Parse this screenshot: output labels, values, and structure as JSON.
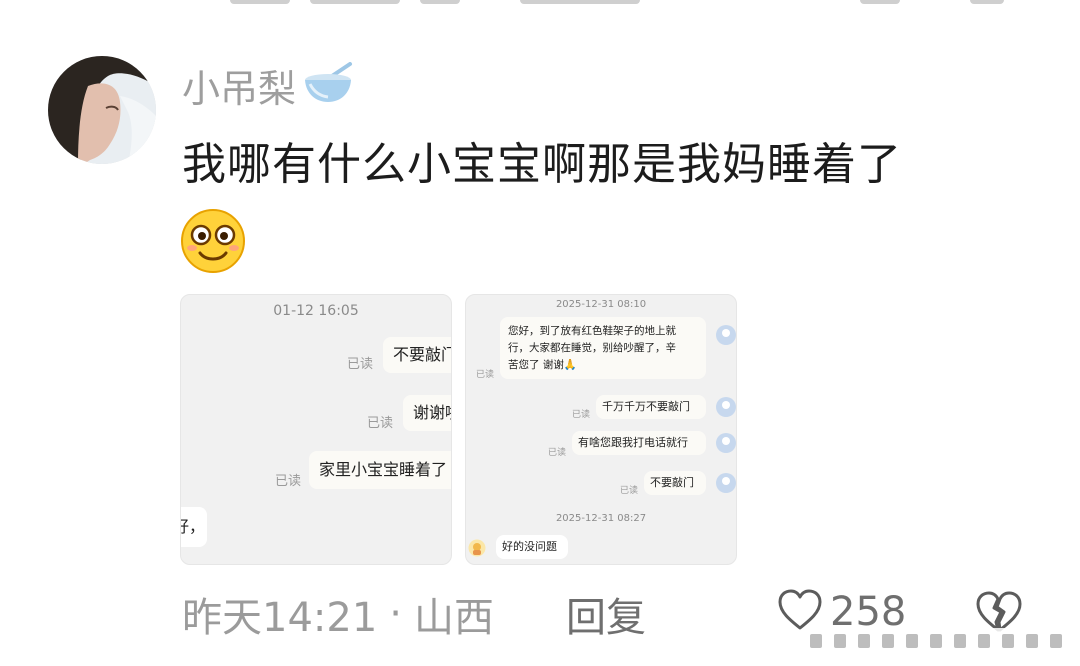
{
  "comment": {
    "username": "小吊梨",
    "text": "我哪有什么小宝宝啊那是我妈睡着了",
    "time": "昨天14:21",
    "separator": "·",
    "location": "山西",
    "reply_label": "回复",
    "like_count": "258"
  },
  "screenshot_left": {
    "timestamp": "01-12 16:05",
    "messages": [
      {
        "read": "已读",
        "text": "不要敲门"
      },
      {
        "read": "已读",
        "text": "谢谢啦"
      },
      {
        "read": "已读",
        "text": "家里小宝宝睡着了"
      }
    ],
    "partial_incoming": "好，"
  },
  "screenshot_right": {
    "timestamp_top": "2025-12-31 08:10",
    "message_long": [
      "您好，到了放有红色鞋架子的地上就",
      "行，大家都在睡觉，别给吵醒了，辛",
      "苦您了 谢谢🙏"
    ],
    "messages": [
      {
        "read": "已读",
        "text": "千万千万不要敲门"
      },
      {
        "read": "已读",
        "text": "有啥您跟我打电话就行"
      },
      {
        "read": "已读",
        "text": "不要敲门"
      }
    ],
    "read_long": "已读",
    "timestamp_bottom": "2025-12-31 08:27",
    "reply_incoming": "好的没问题"
  },
  "colors": {
    "username": "#9e9e9e",
    "bubble": "#fbfaf6",
    "screenshot_bg": "#f1f1f1",
    "avatar_small": "#c7d8ee"
  },
  "icons": {
    "bowl": "bowl-icon",
    "emoji": "smiley-emoji-icon",
    "like": "heart-icon",
    "dislike": "broken-heart-icon"
  }
}
